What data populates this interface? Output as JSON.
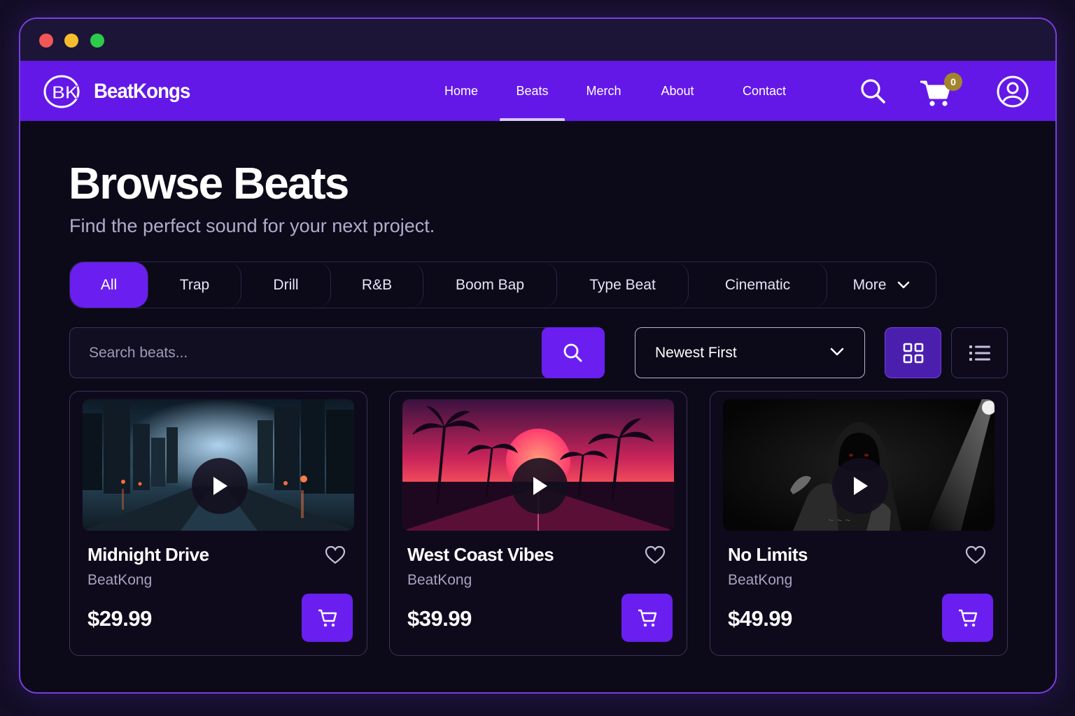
{
  "app": {
    "brand": "BeatKongs",
    "logo_initials": "BK",
    "accent_color": "#6318e8"
  },
  "nav": {
    "links": [
      "Home",
      "Beats",
      "Merch",
      "About",
      "Contact"
    ],
    "active": "Beats",
    "cart_count": "0"
  },
  "page": {
    "title": "Browse Beats",
    "subtitle": "Find the perfect sound for your next project."
  },
  "filters": {
    "genres": [
      "All",
      "Trap",
      "Drill",
      "R&B",
      "Boom Bap",
      "Type Beat",
      "Cinematic",
      "More"
    ],
    "active": "All"
  },
  "search": {
    "placeholder": "Search beats...",
    "value": ""
  },
  "sort": {
    "selected": "Newest First"
  },
  "view": {
    "mode": "grid"
  },
  "beats": [
    {
      "title": "Midnight Drive",
      "artist": "BeatKong",
      "price": "$29.99",
      "image": "rainy-city-street-night"
    },
    {
      "title": "West Coast Vibes",
      "artist": "BeatKong",
      "price": "$39.99",
      "image": "palm-trees-sunset"
    },
    {
      "title": "No Limits",
      "artist": "BeatKong",
      "price": "$49.99",
      "image": "hooded-figure-spotlight"
    }
  ],
  "icons": {
    "search": "search-icon",
    "cart": "cart-icon",
    "account": "user-circle-icon",
    "play": "play-icon",
    "heart": "heart-icon",
    "grid": "grid-view-icon",
    "list": "list-view-icon",
    "chevron": "chevron-down-icon"
  }
}
